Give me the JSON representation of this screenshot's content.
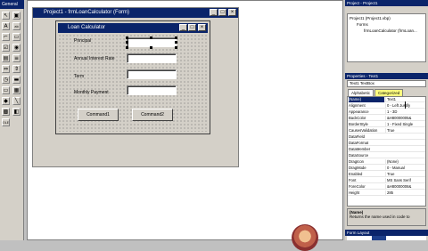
{
  "toolbox": {
    "title": "General",
    "tools": [
      {
        "icon": "pointer-icon",
        "glyph": "↖"
      },
      {
        "icon": "picturebox-icon",
        "glyph": "▣"
      },
      {
        "icon": "label-icon",
        "glyph": "A"
      },
      {
        "icon": "textbox-icon",
        "glyph": "ab"
      },
      {
        "icon": "frame-icon",
        "glyph": "⌐"
      },
      {
        "icon": "commandbutton-icon",
        "glyph": "▭"
      },
      {
        "icon": "checkbox-icon",
        "glyph": "☑"
      },
      {
        "icon": "optionbutton-icon",
        "glyph": "◉"
      },
      {
        "icon": "combobox-icon",
        "glyph": "▤"
      },
      {
        "icon": "listbox-icon",
        "glyph": "≡"
      },
      {
        "icon": "hscrollbar-icon",
        "glyph": "⇔"
      },
      {
        "icon": "vscrollbar-icon",
        "glyph": "⇕"
      },
      {
        "icon": "timer-icon",
        "glyph": "◷"
      },
      {
        "icon": "drivelistbox-icon",
        "glyph": "▬"
      },
      {
        "icon": "dirlistbox-icon",
        "glyph": "▭"
      },
      {
        "icon": "filelistbox-icon",
        "glyph": "▦"
      },
      {
        "icon": "shape-icon",
        "glyph": "◆"
      },
      {
        "icon": "line-icon",
        "glyph": "╲"
      },
      {
        "icon": "image-icon",
        "glyph": "▩"
      },
      {
        "icon": "data-icon",
        "glyph": "◧"
      },
      {
        "icon": "ole-icon",
        "glyph": "OLE"
      }
    ]
  },
  "mdi_window": {
    "title": "Project1 - frmLoanCalculator (Form)"
  },
  "form": {
    "title": "Loan Calculator",
    "labels": {
      "principal": "Principal",
      "rate": "Annual Interest Rate",
      "term": "Term",
      "payment": "Monthly Payment"
    },
    "buttons": {
      "command1": "Command1",
      "command2": "Command2"
    }
  },
  "project": {
    "title": "Project - Project1",
    "root": "Project1 (Project1.vbp)",
    "folder": "Forms",
    "form_item": "frmLoanCalculator (frmLoan..."
  },
  "properties": {
    "title": "Properties - Text1",
    "combo": "Text1  TextBox",
    "tabs": {
      "alphabetic": "Alphabetic",
      "categorized": "Categorized"
    },
    "rows": [
      {
        "name": "(Name)",
        "value": "Text1"
      },
      {
        "name": "Alignment",
        "value": "0 - Left Justify"
      },
      {
        "name": "Appearance",
        "value": "1 - 3D"
      },
      {
        "name": "BackColor",
        "value": "&H80000005&"
      },
      {
        "name": "BorderStyle",
        "value": "1 - Fixed Single"
      },
      {
        "name": "CausesValidation",
        "value": "True"
      },
      {
        "name": "DataField",
        "value": ""
      },
      {
        "name": "DataFormat",
        "value": ""
      },
      {
        "name": "DataMember",
        "value": ""
      },
      {
        "name": "DataSource",
        "value": ""
      },
      {
        "name": "DragIcon",
        "value": "(None)"
      },
      {
        "name": "DragMode",
        "value": "0 - Manual"
      },
      {
        "name": "Enabled",
        "value": "True"
      },
      {
        "name": "Font",
        "value": "MS Sans Serif"
      },
      {
        "name": "ForeColor",
        "value": "&H80000008&"
      },
      {
        "name": "Height",
        "value": "285"
      }
    ],
    "desc_title": "(Name)",
    "desc_text": "Returns the name used in code to"
  },
  "form_layout": {
    "title": "Form Layout"
  },
  "colors": {
    "titlebar": "#0a246a",
    "face": "#d4d0c8",
    "selected_row": "#0a246a"
  }
}
